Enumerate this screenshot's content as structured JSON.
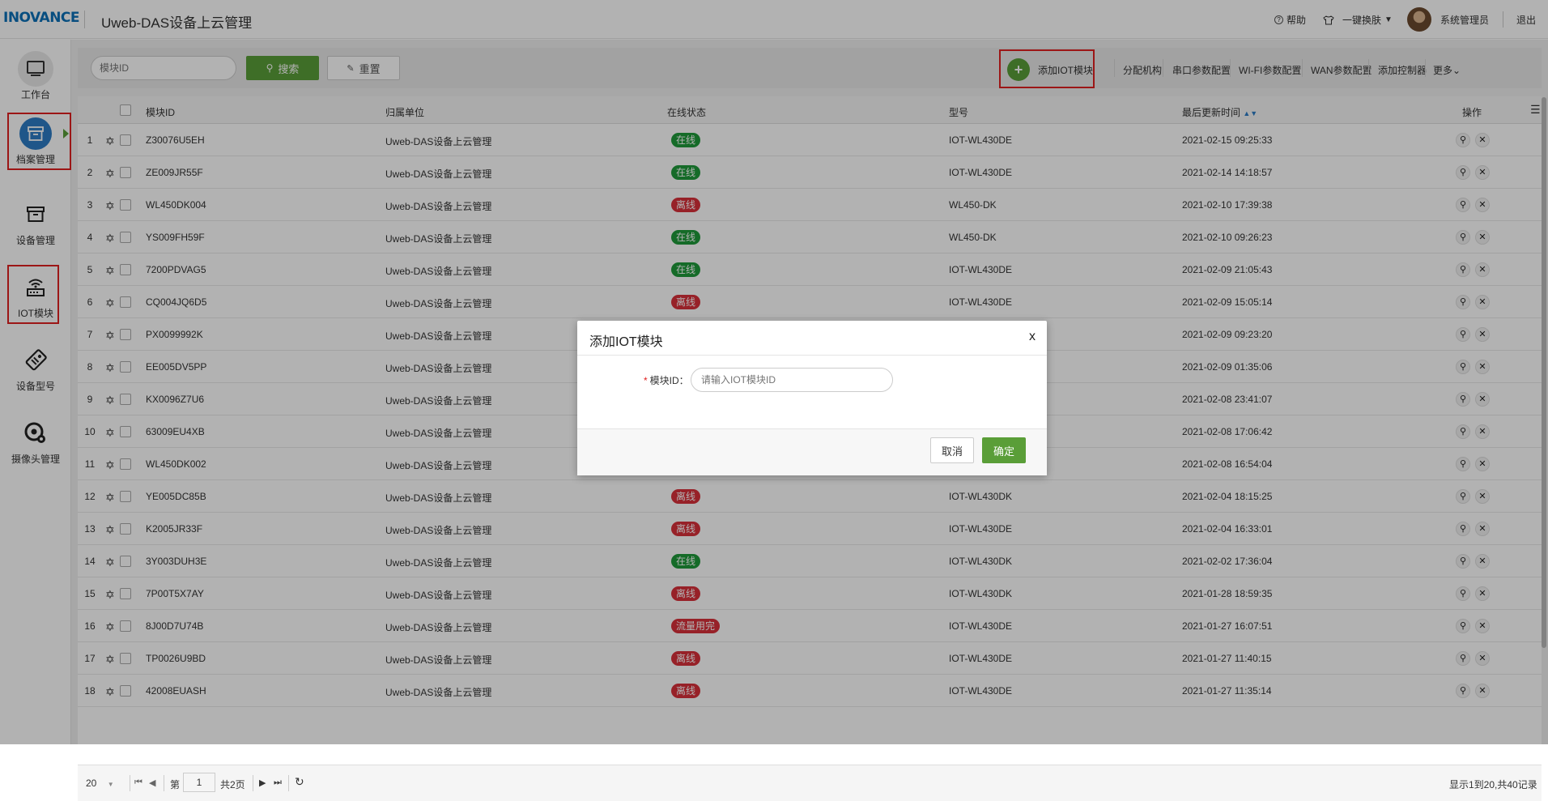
{
  "header": {
    "logo": "INOVANCE",
    "title": "Uweb-DAS设备上云管理",
    "help": "帮助",
    "skin": "一键换肤",
    "user": "系统管理员",
    "logout": "退出"
  },
  "sidebar": {
    "items": [
      {
        "label": "工作台",
        "icon": "monitor-icon"
      },
      {
        "label": "档案管理",
        "icon": "archive-icon"
      },
      {
        "label": "设备管理",
        "icon": "box-icon"
      },
      {
        "label": "IOT模块",
        "icon": "router-icon"
      },
      {
        "label": "设备型号",
        "icon": "tag-icon"
      },
      {
        "label": "摄像头管理",
        "icon": "camera-gear-icon"
      }
    ]
  },
  "toolbar": {
    "search_placeholder": "模块ID",
    "search_label": "搜索",
    "reset_label": "重置",
    "add_iot": "添加IOT模块",
    "links": [
      "分配机构",
      "串口参数配置",
      "WI-FI参数配置",
      "WAN参数配置",
      "添加控制器",
      "更多"
    ]
  },
  "table": {
    "headers": [
      "模块ID",
      "归属单位",
      "在线状态",
      "型号",
      "最后更新时间",
      "操作"
    ],
    "rows": [
      {
        "n": "1",
        "id": "Z30076U5EH",
        "org": "Uweb-DAS设备上云管理",
        "status": "在线",
        "model": "IOT-WL430DE",
        "time": "2021-02-15 09:25:33"
      },
      {
        "n": "2",
        "id": "ZE009JR55F",
        "org": "Uweb-DAS设备上云管理",
        "status": "在线",
        "model": "IOT-WL430DE",
        "time": "2021-02-14 14:18:57"
      },
      {
        "n": "3",
        "id": "WL450DK004",
        "org": "Uweb-DAS设备上云管理",
        "status": "离线",
        "model": "WL450-DK",
        "time": "2021-02-10 17:39:38"
      },
      {
        "n": "4",
        "id": "YS009FH59F",
        "org": "Uweb-DAS设备上云管理",
        "status": "在线",
        "model": "WL450-DK",
        "time": "2021-02-10 09:26:23"
      },
      {
        "n": "5",
        "id": "7200PDVAG5",
        "org": "Uweb-DAS设备上云管理",
        "status": "在线",
        "model": "IOT-WL430DE",
        "time": "2021-02-09 21:05:43"
      },
      {
        "n": "6",
        "id": "CQ004JQ6D5",
        "org": "Uweb-DAS设备上云管理",
        "status": "离线",
        "model": "IOT-WL430DE",
        "time": "2021-02-09 15:05:14"
      },
      {
        "n": "7",
        "id": "PX0099992K",
        "org": "Uweb-DAS设备上云管理",
        "status": "",
        "model": "",
        "time": "2021-02-09 09:23:20"
      },
      {
        "n": "8",
        "id": "EE005DV5PP",
        "org": "Uweb-DAS设备上云管理",
        "status": "",
        "model": "",
        "time": "2021-02-09 01:35:06"
      },
      {
        "n": "9",
        "id": "KX0096Z7U6",
        "org": "Uweb-DAS设备上云管理",
        "status": "",
        "model": "",
        "time": "2021-02-08 23:41:07"
      },
      {
        "n": "10",
        "id": "63009EU4XB",
        "org": "Uweb-DAS设备上云管理",
        "status": "",
        "model": "",
        "time": "2021-02-08 17:06:42"
      },
      {
        "n": "11",
        "id": "WL450DK002",
        "org": "Uweb-DAS设备上云管理",
        "status": "",
        "model": "",
        "time": "2021-02-08 16:54:04"
      },
      {
        "n": "12",
        "id": "YE005DC85B",
        "org": "Uweb-DAS设备上云管理",
        "status": "离线",
        "model": "IOT-WL430DK",
        "time": "2021-02-04 18:15:25"
      },
      {
        "n": "13",
        "id": "K2005JR33F",
        "org": "Uweb-DAS设备上云管理",
        "status": "离线",
        "model": "IOT-WL430DE",
        "time": "2021-02-04 16:33:01"
      },
      {
        "n": "14",
        "id": "3Y003DUH3E",
        "org": "Uweb-DAS设备上云管理",
        "status": "在线",
        "model": "IOT-WL430DK",
        "time": "2021-02-02 17:36:04"
      },
      {
        "n": "15",
        "id": "7P00T5X7AY",
        "org": "Uweb-DAS设备上云管理",
        "status": "离线",
        "model": "IOT-WL430DK",
        "time": "2021-01-28 18:59:35"
      },
      {
        "n": "16",
        "id": "8J00D7U74B",
        "org": "Uweb-DAS设备上云管理",
        "status": "流量用完",
        "model": "IOT-WL430DE",
        "time": "2021-01-27 16:07:51"
      },
      {
        "n": "17",
        "id": "TP0026U9BD",
        "org": "Uweb-DAS设备上云管理",
        "status": "离线",
        "model": "IOT-WL430DE",
        "time": "2021-01-27 11:40:15"
      },
      {
        "n": "18",
        "id": "42008EUASH",
        "org": "Uweb-DAS设备上云管理",
        "status": "离线",
        "model": "IOT-WL430DE",
        "time": "2021-01-27 11:35:14"
      }
    ]
  },
  "pager": {
    "page_size": "20",
    "page_prefix": "第",
    "page": "1",
    "total_pages": "共2页",
    "summary": "显示1到20,共40记录"
  },
  "dialog": {
    "title": "添加IOT模块",
    "close": "x",
    "required_mark": "*",
    "field_label": "模块ID：",
    "field_placeholder": "请输入IOT模块ID",
    "cancel": "取消",
    "ok": "确定"
  },
  "colors": {
    "accent_green": "#5a9e38",
    "online": "#1f9a3a",
    "offline": "#d9303a",
    "highlight_box": "#e02020",
    "brand_blue": "#0c70b8"
  }
}
